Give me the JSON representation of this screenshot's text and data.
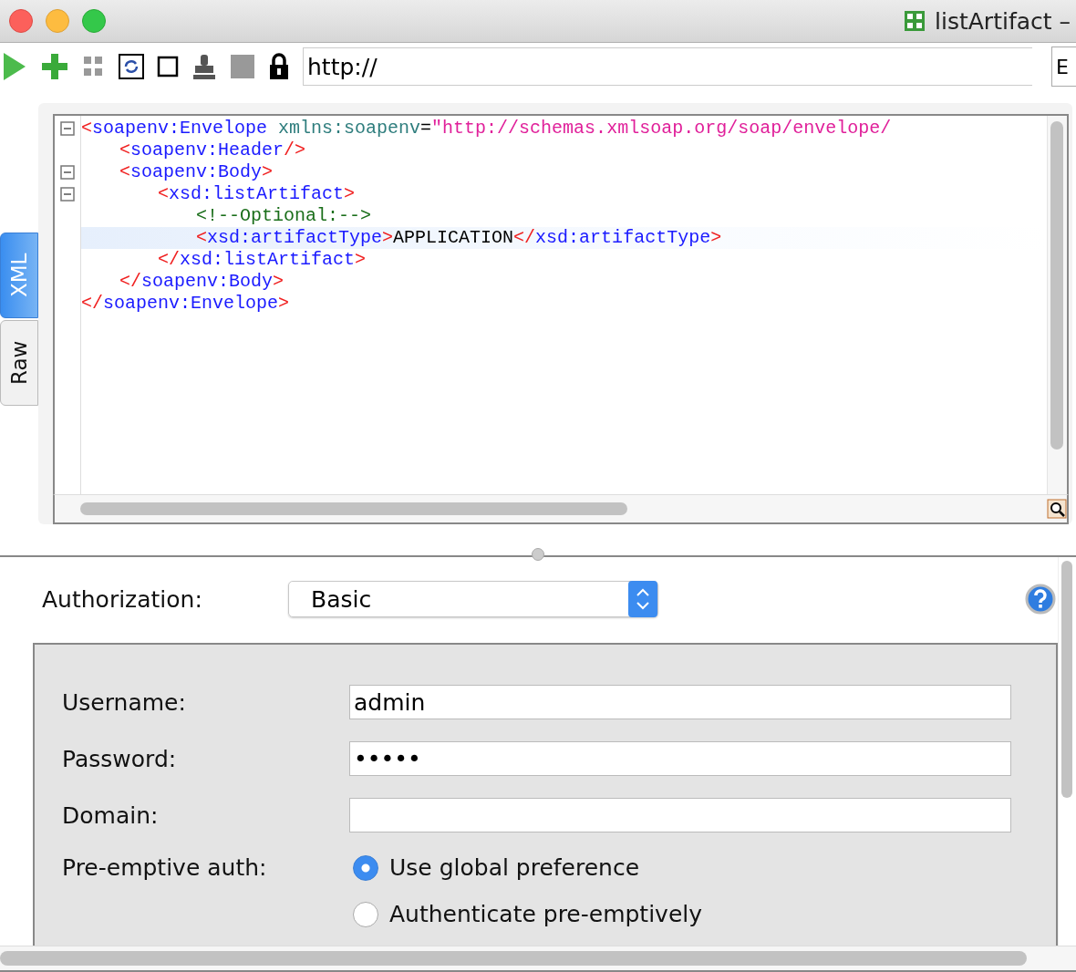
{
  "window": {
    "title": "listArtifact –"
  },
  "toolbar": {
    "url_field": {
      "value": "http://"
    },
    "field_2": {
      "value": "E"
    }
  },
  "editor": {
    "tabs": [
      {
        "label": "XML",
        "selected": true
      },
      {
        "label": "Raw",
        "selected": false
      }
    ],
    "lines": [
      {
        "foldable": true,
        "highlighted": false,
        "tokens": [
          {
            "kind": "bracket",
            "text": "<"
          },
          {
            "kind": "tag",
            "text": "soapenv:Envelope"
          },
          {
            "kind": "attr",
            "text": " xmlns:soapenv"
          },
          {
            "kind": "plain",
            "text": "="
          },
          {
            "kind": "string",
            "text": "\"http://schemas.xmlsoap.org/soap/envelope/"
          }
        ],
        "children": [
          {
            "foldable": false,
            "highlighted": false,
            "tokens": [
              {
                "kind": "bracket",
                "text": "<"
              },
              {
                "kind": "tag",
                "text": "soapenv:Header"
              },
              {
                "kind": "bracket",
                "text": "/>"
              }
            ]
          },
          {
            "foldable": true,
            "highlighted": false,
            "tokens": [
              {
                "kind": "bracket",
                "text": "<"
              },
              {
                "kind": "tag",
                "text": "soapenv:Body"
              },
              {
                "kind": "bracket",
                "text": ">"
              }
            ],
            "children": [
              {
                "foldable": true,
                "highlighted": false,
                "tokens": [
                  {
                    "kind": "bracket",
                    "text": "<"
                  },
                  {
                    "kind": "tag",
                    "text": "xsd:listArtifact"
                  },
                  {
                    "kind": "bracket",
                    "text": ">"
                  }
                ],
                "children": [
                  {
                    "foldable": false,
                    "highlighted": false,
                    "tokens": [
                      {
                        "kind": "comment",
                        "text": "<!--Optional:-->"
                      }
                    ]
                  },
                  {
                    "foldable": false,
                    "highlighted": true,
                    "tokens": [
                      {
                        "kind": "bracket",
                        "text": "<"
                      },
                      {
                        "kind": "tag",
                        "text": "xsd:artifactType"
                      },
                      {
                        "kind": "bracket",
                        "text": ">"
                      },
                      {
                        "kind": "plain",
                        "text": "APPLICATION"
                      },
                      {
                        "kind": "bracket",
                        "text": "</"
                      },
                      {
                        "kind": "tag",
                        "text": "xsd:artifactType"
                      },
                      {
                        "kind": "bracket",
                        "text": ">"
                      }
                    ]
                  }
                ]
              },
              {
                "foldable": false,
                "highlighted": false,
                "tokens": [
                  {
                    "kind": "bracket",
                    "text": "</"
                  },
                  {
                    "kind": "tag",
                    "text": "xsd:listArtifact"
                  },
                  {
                    "kind": "bracket",
                    "text": ">"
                  }
                ]
              }
            ]
          },
          {
            "foldable": false,
            "highlighted": false,
            "tokens": [
              {
                "kind": "bracket",
                "text": "</"
              },
              {
                "kind": "tag",
                "text": "soapenv:Body"
              },
              {
                "kind": "bracket",
                "text": ">"
              }
            ]
          }
        ]
      },
      {
        "foldable": false,
        "highlighted": false,
        "tokens": [
          {
            "kind": "bracket",
            "text": "</"
          },
          {
            "kind": "tag",
            "text": "soapenv:Envelope"
          },
          {
            "kind": "bracket",
            "text": ">"
          }
        ]
      }
    ]
  },
  "auth": {
    "label": "Authorization:",
    "type_select": {
      "value": "Basic"
    },
    "fields": [
      {
        "label": "Username:",
        "value": "admin"
      },
      {
        "label": "Password:",
        "value": "•••••"
      },
      {
        "label": "Domain:"
      }
    ],
    "preemptive": {
      "label": "Pre-emptive auth:",
      "options": [
        {
          "label": "Use global preference",
          "selected": true
        },
        {
          "label": "Authenticate pre-emptively",
          "selected": false
        }
      ]
    }
  }
}
